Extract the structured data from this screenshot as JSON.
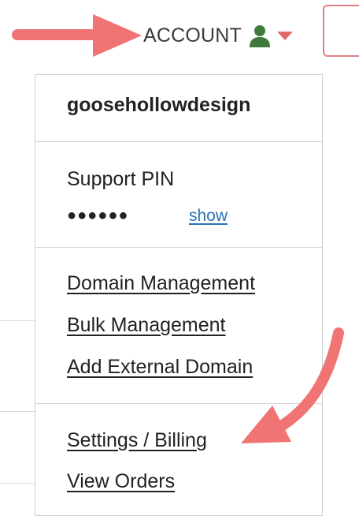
{
  "header": {
    "account_label": "ACCOUNT",
    "user_icon": "user-icon",
    "caret_icon": "caret-down-icon"
  },
  "dropdown": {
    "username": "goosehollowdesign",
    "support_pin_label": "Support PIN",
    "pin_masked": "●●●●●●",
    "show_label": "show",
    "links": [
      "Domain Management",
      "Bulk Management",
      "Add External Domain"
    ],
    "account_links": [
      "Settings / Billing",
      "View Orders"
    ]
  },
  "colors": {
    "annotation_arrow": "#f07474",
    "user_icon": "#3f7a3c",
    "caret": "#e06a6a",
    "link_blue": "#2a72b5"
  }
}
